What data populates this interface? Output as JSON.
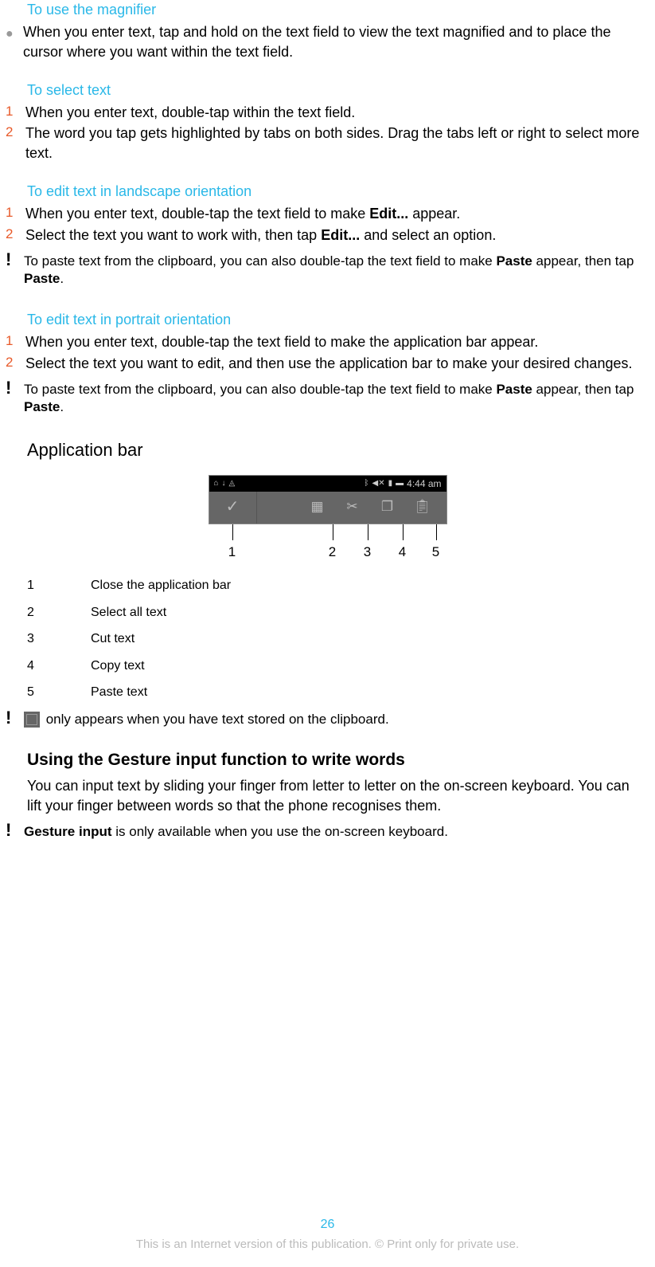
{
  "sections": {
    "magnifier": {
      "title": "To use the magnifier",
      "items": {
        "i1": "When you enter text, tap and hold on the text field to view the text magnified and to place the cursor where you want within the text field."
      }
    },
    "select_text": {
      "title": "To select text",
      "items": {
        "i1": "When you enter text, double-tap within the text field.",
        "i2": "The word you tap gets highlighted by tabs on both sides. Drag the tabs left or right to select more text."
      }
    },
    "edit_landscape": {
      "title": "To edit text in landscape orientation",
      "items": {
        "i1_pre": "When you enter text, double-tap the text field to make ",
        "i1_bold": "Edit...",
        "i1_post": " appear.",
        "i2_pre": "Select the text you want to work with, then tap ",
        "i2_bold": "Edit...",
        "i2_post": " and select an option."
      },
      "tip": {
        "pre": "To paste text from the clipboard, you can also double-tap the text field to make ",
        "b1": "Paste",
        "mid": " appear, then tap ",
        "b2": "Paste",
        "post": "."
      }
    },
    "edit_portrait": {
      "title": "To edit text in portrait orientation",
      "items": {
        "i1": "When you enter text, double-tap the text field to make the application bar appear.",
        "i2": "Select the text you want to edit, and then use the application bar to make your desired changes."
      },
      "tip": {
        "pre": "To paste text from the clipboard, you can also double-tap the text field to make ",
        "b1": "Paste",
        "mid": " appear, then tap ",
        "b2": "Paste",
        "post": "."
      }
    },
    "appbar": {
      "title": "Application bar",
      "status_time": "4:44 am",
      "callouts": {
        "c1": "1",
        "c2": "2",
        "c3": "3",
        "c4": "4",
        "c5": "5"
      },
      "legend": {
        "r1": {
          "num": "1",
          "text": "Close the application bar"
        },
        "r2": {
          "num": "2",
          "text": "Select all text"
        },
        "r3": {
          "num": "3",
          "text": "Cut text"
        },
        "r4": {
          "num": "4",
          "text": "Copy text"
        },
        "r5": {
          "num": "5",
          "text": "Paste text"
        }
      },
      "tip": " only appears when you have text stored on the clipboard."
    },
    "gesture": {
      "title": "Using the Gesture input function to write words",
      "para": "You can input text by sliding your finger from letter to letter on the on-screen keyboard. You can lift your finger between words so that the phone recognises them.",
      "tip": {
        "b1": "Gesture input",
        "post": " is only available when you use the on-screen keyboard."
      }
    }
  },
  "footer": {
    "page": "26",
    "text": "This is an Internet version of this publication. © Print only for private use."
  }
}
